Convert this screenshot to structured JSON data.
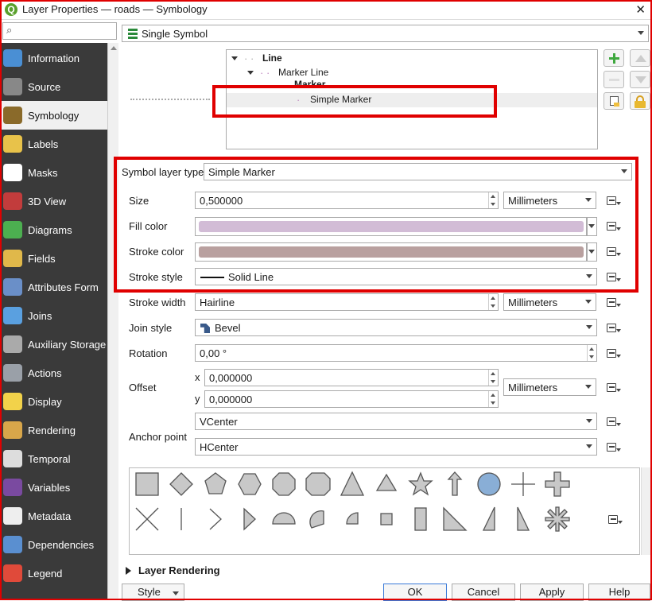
{
  "window": {
    "title": "Layer Properties — roads — Symbology"
  },
  "sidebar": {
    "items": [
      {
        "label": "Information",
        "icon": "information-icon",
        "color": "#4a8fd4"
      },
      {
        "label": "Source",
        "icon": "source-icon",
        "color": "#888888"
      },
      {
        "label": "Symbology",
        "icon": "symbology-icon",
        "color": "#8a6a2a"
      },
      {
        "label": "Labels",
        "icon": "labels-icon",
        "color": "#e8c24a"
      },
      {
        "label": "Masks",
        "icon": "masks-icon",
        "color": "#ffffff"
      },
      {
        "label": "3D View",
        "icon": "3d-view-icon",
        "color": "#c23c3c"
      },
      {
        "label": "Diagrams",
        "icon": "diagrams-icon",
        "color": "#4caf50"
      },
      {
        "label": "Fields",
        "icon": "fields-icon",
        "color": "#e0b84a"
      },
      {
        "label": "Attributes Form",
        "icon": "attributes-form-icon",
        "color": "#6a8fc8"
      },
      {
        "label": "Joins",
        "icon": "joins-icon",
        "color": "#5aa0e0"
      },
      {
        "label": "Auxiliary Storage",
        "icon": "auxiliary-storage-icon",
        "color": "#aaaaaa"
      },
      {
        "label": "Actions",
        "icon": "actions-icon",
        "color": "#9aa0a8"
      },
      {
        "label": "Display",
        "icon": "display-icon",
        "color": "#f2d24a"
      },
      {
        "label": "Rendering",
        "icon": "rendering-icon",
        "color": "#d8a64a"
      },
      {
        "label": "Temporal",
        "icon": "temporal-icon",
        "color": "#dddddd"
      },
      {
        "label": "Variables",
        "icon": "variables-icon",
        "color": "#7a4aa0"
      },
      {
        "label": "Metadata",
        "icon": "metadata-icon",
        "color": "#eeeeee"
      },
      {
        "label": "Dependencies",
        "icon": "dependencies-icon",
        "color": "#5a8fd0"
      },
      {
        "label": "Legend",
        "icon": "legend-icon",
        "color": "#e04a3a"
      }
    ],
    "selected": "Symbology"
  },
  "renderer": {
    "value": "Single Symbol"
  },
  "tree": {
    "line": "Line",
    "marker_line": "Marker Line",
    "marker": "Marker",
    "simple_marker": "Simple Marker"
  },
  "form": {
    "symbol_layer_type_label": "Symbol layer type",
    "symbol_layer_type_value": "Simple Marker",
    "size_label": "Size",
    "size_value": "0,500000",
    "size_unit": "Millimeters",
    "fill_color_label": "Fill color",
    "fill_color": "#d2bcd6",
    "stroke_color_label": "Stroke color",
    "stroke_color": "#b9a09f",
    "stroke_style_label": "Stroke style",
    "stroke_style_value": "Solid Line",
    "stroke_width_label": "Stroke width",
    "stroke_width_value": "Hairline",
    "stroke_width_unit": "Millimeters",
    "join_style_label": "Join style",
    "join_style_value": "Bevel",
    "rotation_label": "Rotation",
    "rotation_value": "0,00 °",
    "offset_label": "Offset",
    "offset_x_label": "x",
    "offset_x_value": "0,000000",
    "offset_y_label": "y",
    "offset_y_value": "0,000000",
    "offset_unit": "Millimeters",
    "anchor_label": "Anchor point",
    "anchor_v": "VCenter",
    "anchor_h": "HCenter"
  },
  "markers": [
    "square",
    "diamond",
    "pentagon",
    "hexagon",
    "octagon",
    "decagon",
    "triangle",
    "equilateral-triangle",
    "star",
    "arrow",
    "circle",
    "cross",
    "cross-fill",
    "cross2",
    "line",
    "arrowhead",
    "filled-arrowhead",
    "semi-circle",
    "third-circle",
    "quarter-circle",
    "quarter-square",
    "half-square",
    "diagonal-half-square",
    "right-half-triangle",
    "left-half-triangle",
    "asterisk-fill"
  ],
  "sections": {
    "layer_rendering": "Layer Rendering"
  },
  "buttons": {
    "style": "Style",
    "ok": "OK",
    "cancel": "Cancel",
    "apply": "Apply",
    "help": "Help"
  }
}
